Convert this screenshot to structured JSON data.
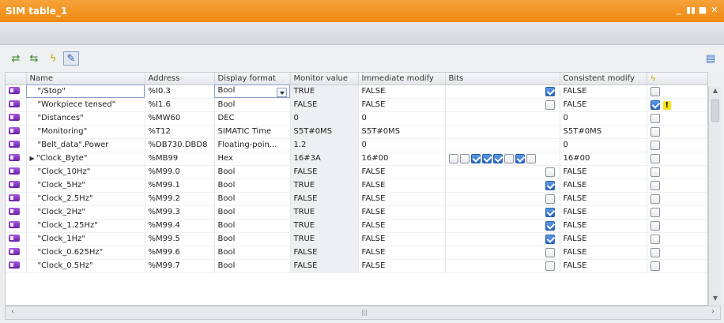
{
  "window": {
    "title": "SIM table_1",
    "controls": [
      "_",
      "▮▮",
      "■",
      "✕"
    ]
  },
  "toolbar": {
    "icons": [
      "insert-row-icon",
      "add-row-icon",
      "lightning-icon",
      "modify-icon",
      "side-panel-icon"
    ]
  },
  "table": {
    "columns": [
      "",
      "Name",
      "Address",
      "Display format",
      "Monitor value",
      "Immediate modify",
      "Bits",
      "Consistent modify",
      ""
    ],
    "rows": [
      {
        "name": "\"/Stop\"",
        "address": "%I0.3",
        "format": "Bool",
        "monitor": "TRUE",
        "immediate": "FALSE",
        "bits": [
          true
        ],
        "consistent": "FALSE",
        "consistent_checked": false,
        "right_checked": false,
        "warning": false
      },
      {
        "name": "\"Workpiece tensed\"",
        "address": "%I1.6",
        "format": "Bool",
        "monitor": "FALSE",
        "immediate": "FALSE",
        "bits": [
          false
        ],
        "consistent": "FALSE",
        "consistent_checked": false,
        "right_checked": true,
        "warning": true
      },
      {
        "name": "\"Distances\"",
        "address": "%MW60",
        "format": "DEC",
        "monitor": "0",
        "immediate": "0",
        "bits": [],
        "consistent": "0",
        "consistent_checked": false,
        "right_checked": false,
        "warning": false
      },
      {
        "name": "\"Monitoring\"",
        "address": "%T12",
        "format": "SIMATIC Time",
        "monitor": "S5T#0MS",
        "immediate": "S5T#0MS",
        "bits": [],
        "consistent": "S5T#0MS",
        "consistent_checked": false,
        "right_checked": false,
        "warning": false
      },
      {
        "name": "\"Belt_data\".Power",
        "address": "%DB730.DBD8",
        "format": "Floating-poin...",
        "monitor": "1.2",
        "immediate": "0",
        "bits": [],
        "consistent": "0",
        "consistent_checked": false,
        "right_checked": false,
        "warning": false
      },
      {
        "name": "\"Clock_Byte\"",
        "address": "%MB99",
        "format": "Hex",
        "monitor": "16#3A",
        "immediate": "16#00",
        "bits": [
          false,
          false,
          true,
          true,
          true,
          false,
          true,
          false
        ],
        "consistent": "16#00",
        "consistent_checked": false,
        "right_checked": false,
        "warning": false,
        "expandable": true
      },
      {
        "name": "\"Clock_10Hz\"",
        "address": "%M99.0",
        "format": "Bool",
        "monitor": "FALSE",
        "immediate": "FALSE",
        "bits": [
          false
        ],
        "consistent": "FALSE",
        "consistent_checked": false,
        "right_checked": false,
        "warning": false
      },
      {
        "name": "\"Clock_5Hz\"",
        "address": "%M99.1",
        "format": "Bool",
        "monitor": "TRUE",
        "immediate": "FALSE",
        "bits": [
          true
        ],
        "consistent": "FALSE",
        "consistent_checked": false,
        "right_checked": false,
        "warning": false
      },
      {
        "name": "\"Clock_2.5Hz\"",
        "address": "%M99.2",
        "format": "Bool",
        "monitor": "FALSE",
        "immediate": "FALSE",
        "bits": [
          false
        ],
        "consistent": "FALSE",
        "consistent_checked": false,
        "right_checked": false,
        "warning": false
      },
      {
        "name": "\"Clock_2Hz\"",
        "address": "%M99.3",
        "format": "Bool",
        "monitor": "TRUE",
        "immediate": "FALSE",
        "bits": [
          true
        ],
        "consistent": "FALSE",
        "consistent_checked": false,
        "right_checked": false,
        "warning": false
      },
      {
        "name": "\"Clock_1.25Hz\"",
        "address": "%M99.4",
        "format": "Bool",
        "monitor": "TRUE",
        "immediate": "FALSE",
        "bits": [
          true
        ],
        "consistent": "FALSE",
        "consistent_checked": false,
        "right_checked": false,
        "warning": false
      },
      {
        "name": "\"Clock_1Hz\"",
        "address": "%M99.5",
        "format": "Bool",
        "monitor": "TRUE",
        "immediate": "FALSE",
        "bits": [
          true
        ],
        "consistent": "FALSE",
        "consistent_checked": false,
        "right_checked": false,
        "warning": false
      },
      {
        "name": "\"Clock_0.625Hz\"",
        "address": "%M99.6",
        "format": "Bool",
        "monitor": "FALSE",
        "immediate": "FALSE",
        "bits": [
          false
        ],
        "consistent": "FALSE",
        "consistent_checked": false,
        "right_checked": false,
        "warning": false
      },
      {
        "name": "\"Clock_0.5Hz\"",
        "address": "%M99.7",
        "format": "Bool",
        "monitor": "FALSE",
        "immediate": "FALSE",
        "bits": [
          false
        ],
        "consistent": "FALSE",
        "consistent_checked": false,
        "right_checked": false,
        "warning": false
      }
    ]
  },
  "colors": {
    "title_bar": "#ef8a10",
    "row_icon": "#7a2bbd",
    "checkbox_on": "#2a67c4"
  }
}
